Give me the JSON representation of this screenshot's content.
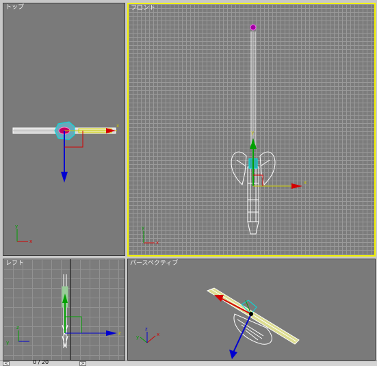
{
  "viewports": {
    "top": {
      "label": "トップ"
    },
    "front": {
      "label": "フロント"
    },
    "left": {
      "label": "レフト"
    },
    "perspective": {
      "label": "パースペクティブ"
    }
  },
  "axis_labels": {
    "x": "x",
    "y": "y",
    "z": "z"
  },
  "statusbar": {
    "frame_text": "0 / 20"
  },
  "colors": {
    "active_border": "#f2f200",
    "viewport_bg": "#7a7a7a",
    "axis_x": "#d40000",
    "axis_y": "#00a000",
    "axis_z": "#0000d0",
    "mesh": "#ffffff"
  }
}
